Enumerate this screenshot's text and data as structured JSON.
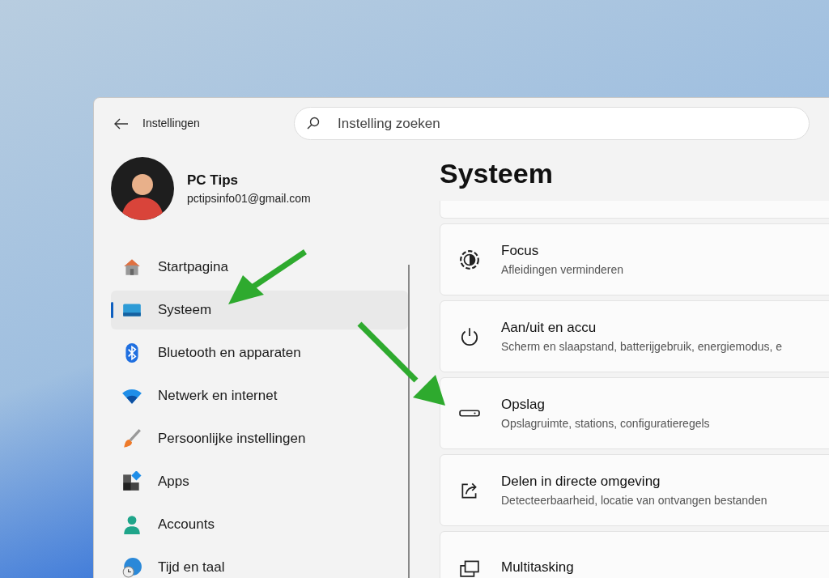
{
  "window": {
    "title": "Instellingen"
  },
  "search": {
    "placeholder": "Instelling zoeken"
  },
  "profile": {
    "name": "PC Tips",
    "email": "pctipsinfo01@gmail.com"
  },
  "sidebar": {
    "items": [
      {
        "label": "Startpagina",
        "kind": "home",
        "selected": false
      },
      {
        "label": "Systeem",
        "kind": "system",
        "selected": true
      },
      {
        "label": "Bluetooth en apparaten",
        "kind": "bluetooth",
        "selected": false
      },
      {
        "label": "Netwerk en internet",
        "kind": "network",
        "selected": false
      },
      {
        "label": "Persoonlijke instellingen",
        "kind": "brush",
        "selected": false
      },
      {
        "label": "Apps",
        "kind": "apps",
        "selected": false
      },
      {
        "label": "Accounts",
        "kind": "accounts",
        "selected": false
      },
      {
        "label": "Tijd en taal",
        "kind": "time",
        "selected": false
      }
    ]
  },
  "page": {
    "title": "Systeem",
    "cards": [
      {
        "title": "Focus",
        "subtitle": "Afleidingen verminderen",
        "kind": "focus"
      },
      {
        "title": "Aan/uit en accu",
        "subtitle": "Scherm en slaapstand, batterijgebruik, energiemodus, e",
        "kind": "power"
      },
      {
        "title": "Opslag",
        "subtitle": "Opslagruimte, stations, configuratieregels",
        "kind": "storage"
      },
      {
        "title": "Delen in directe omgeving",
        "subtitle": "Detecteerbaarheid, locatie van ontvangen bestanden",
        "kind": "share"
      },
      {
        "title": "Multitasking",
        "kind": "multitask"
      }
    ]
  }
}
